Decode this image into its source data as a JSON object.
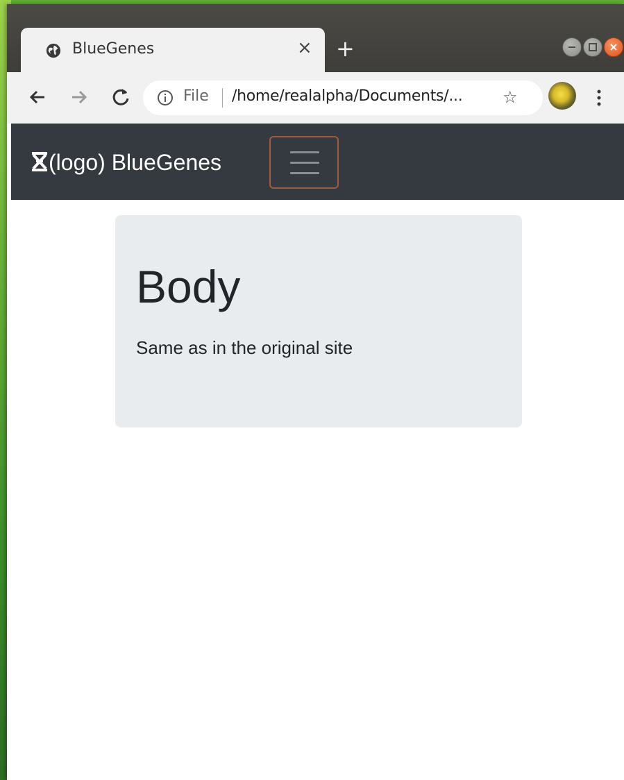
{
  "browser": {
    "tab": {
      "title": "BlueGenes",
      "favicon": "globe-icon",
      "close_label": "×"
    },
    "new_tab_label": "+",
    "toolbar": {
      "back_icon": "back-arrow-icon",
      "forward_icon": "forward-arrow-icon",
      "reload_icon": "reload-icon",
      "info_icon": "info-icon",
      "scheme_label": "File",
      "url": "/home/realalpha/Documents/...",
      "bookmark_icon": "star-icon",
      "menu_icon": "kebab-menu-icon"
    },
    "window_controls": [
      "minimize",
      "maximize",
      "close"
    ]
  },
  "page": {
    "navbar": {
      "brand_text": "(logo) BlueGenes",
      "brand_icon": "dna-icon",
      "toggler_icon": "hamburger-icon",
      "background": "#343a40"
    },
    "jumbotron": {
      "title": "Body",
      "text": "Same as in the original site",
      "background": "#e9ecef"
    }
  },
  "colors": {
    "toggler_border": "#a35a3a",
    "tabstrip": "#3e3d39",
    "close_button": "#e0531e"
  }
}
